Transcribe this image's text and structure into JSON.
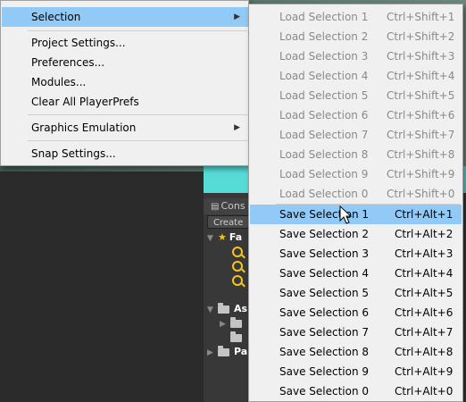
{
  "background": {
    "console_tab_label": "Cons",
    "create_button_label": "Create",
    "tree": {
      "favorites_label": "Fa",
      "assets_label": "As",
      "packages_label": "Pa"
    }
  },
  "main_menu": {
    "items": [
      {
        "label": "Selection",
        "has_submenu": true,
        "active": true
      },
      {
        "label": "Project Settings..."
      },
      {
        "label": "Preferences..."
      },
      {
        "label": "Modules..."
      },
      {
        "label": "Clear All PlayerPrefs"
      },
      {
        "label": "Graphics Emulation",
        "has_submenu": true
      },
      {
        "label": "Snap Settings..."
      }
    ]
  },
  "selection_submenu": {
    "load_items": [
      {
        "label": "Load Selection 1",
        "shortcut": "Ctrl+Shift+1",
        "enabled": false
      },
      {
        "label": "Load Selection 2",
        "shortcut": "Ctrl+Shift+2",
        "enabled": false
      },
      {
        "label": "Load Selection 3",
        "shortcut": "Ctrl+Shift+3",
        "enabled": false
      },
      {
        "label": "Load Selection 4",
        "shortcut": "Ctrl+Shift+4",
        "enabled": false
      },
      {
        "label": "Load Selection 5",
        "shortcut": "Ctrl+Shift+5",
        "enabled": false
      },
      {
        "label": "Load Selection 6",
        "shortcut": "Ctrl+Shift+6",
        "enabled": false
      },
      {
        "label": "Load Selection 7",
        "shortcut": "Ctrl+Shift+7",
        "enabled": false
      },
      {
        "label": "Load Selection 8",
        "shortcut": "Ctrl+Shift+8",
        "enabled": false
      },
      {
        "label": "Load Selection 9",
        "shortcut": "Ctrl+Shift+9",
        "enabled": false
      },
      {
        "label": "Load Selection 0",
        "shortcut": "Ctrl+Shift+0",
        "enabled": false
      }
    ],
    "save_items": [
      {
        "label": "Save Selection 1",
        "shortcut": "Ctrl+Alt+1",
        "hovered": true
      },
      {
        "label": "Save Selection 2",
        "shortcut": "Ctrl+Alt+2"
      },
      {
        "label": "Save Selection 3",
        "shortcut": "Ctrl+Alt+3"
      },
      {
        "label": "Save Selection 4",
        "shortcut": "Ctrl+Alt+4"
      },
      {
        "label": "Save Selection 5",
        "shortcut": "Ctrl+Alt+5"
      },
      {
        "label": "Save Selection 6",
        "shortcut": "Ctrl+Alt+6"
      },
      {
        "label": "Save Selection 7",
        "shortcut": "Ctrl+Alt+7"
      },
      {
        "label": "Save Selection 8",
        "shortcut": "Ctrl+Alt+8"
      },
      {
        "label": "Save Selection 9",
        "shortcut": "Ctrl+Alt+9"
      },
      {
        "label": "Save Selection 0",
        "shortcut": "Ctrl+Alt+0"
      }
    ]
  },
  "colors": {
    "highlight": "#91c9f7",
    "menu_background": "#f0f0f0",
    "disabled_text": "#8a8a8a"
  }
}
